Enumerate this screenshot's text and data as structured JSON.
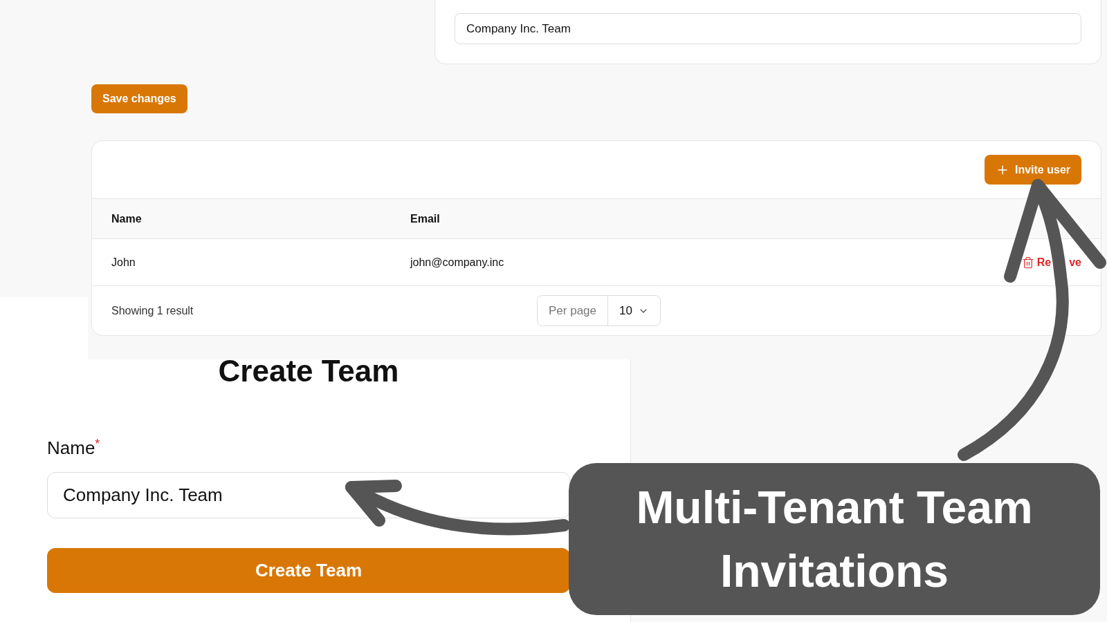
{
  "top_card": {
    "name_input": {
      "value": "Company Inc. Team"
    }
  },
  "save_button": "Save changes",
  "members_table": {
    "invite_button": "Invite user",
    "columns": [
      "Name",
      "Email"
    ],
    "rows": [
      {
        "name": "John",
        "email": "john@company.inc",
        "action": "Re",
        "action_tail": "ve"
      }
    ],
    "footer": {
      "summary": "Showing 1 result",
      "per_page_label": "Per page",
      "per_page_value": "10"
    }
  },
  "create_team": {
    "title": "Create Team",
    "field_label": "Name",
    "required_mark": "*",
    "name_input": {
      "value": "Company Inc. Team"
    },
    "submit_button": "Create Team"
  },
  "caption": "Multi-Tenant Team Invitations"
}
